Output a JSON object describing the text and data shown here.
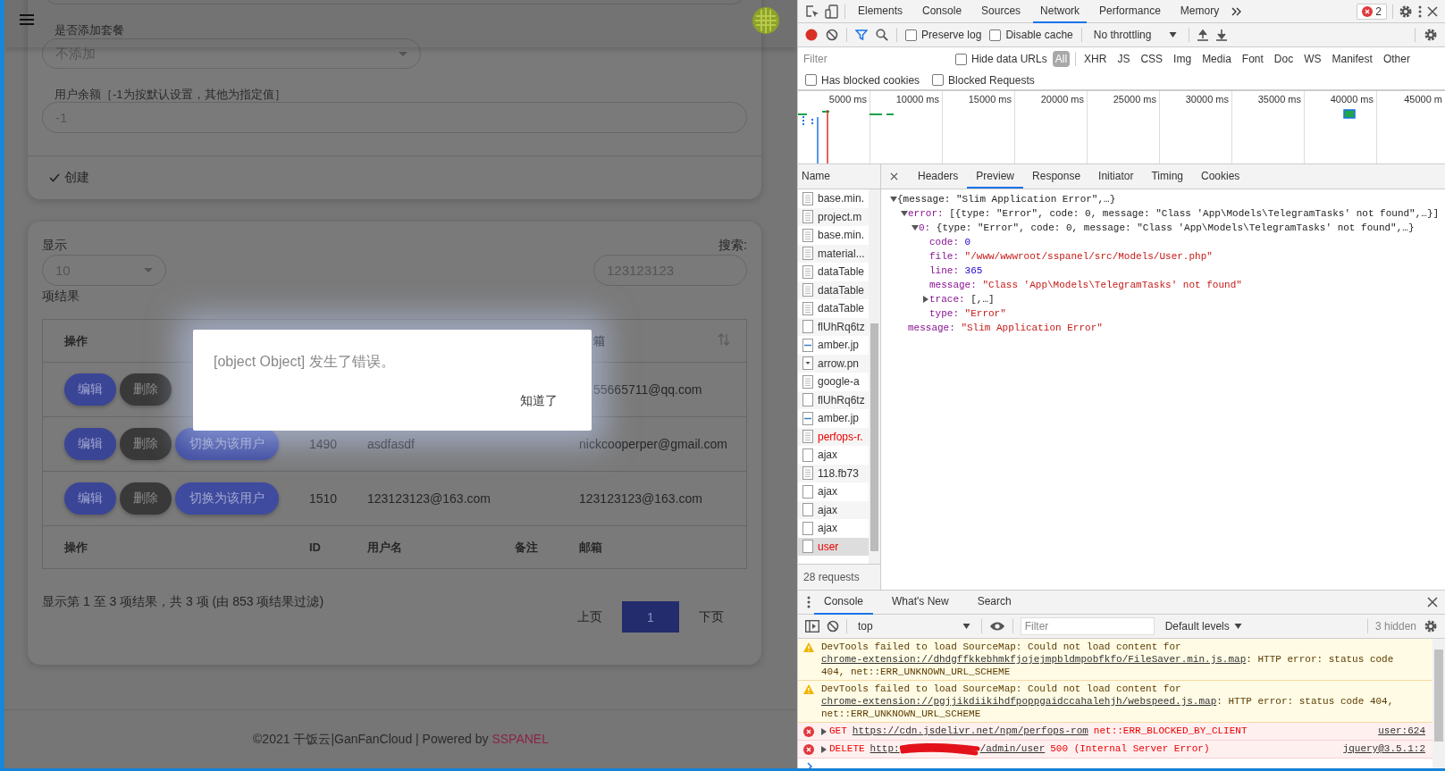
{
  "page": {
    "form": {
      "package_label": "是否添加套餐",
      "package_value": "不添加",
      "balance_label": "用户余额［-1为按默认设置，其他为指定值］",
      "balance_value": "-1",
      "create_button": "创建"
    },
    "list": {
      "show_label": "显示",
      "page_size": "10",
      "results_label": "项结果",
      "search_label": "搜索:",
      "search_value": "123123123",
      "header": {
        "actions": "操作",
        "email": "箱"
      },
      "rows": [
        {
          "buttons": [
            {
              "kind": "edit",
              "label": "编辑"
            },
            {
              "kind": "delete",
              "label": "删除"
            }
          ],
          "email": "55665711@qq.com"
        },
        {
          "buttons": [
            {
              "kind": "edit",
              "label": "编辑"
            },
            {
              "kind": "delete",
              "label": "删除"
            },
            {
              "kind": "switch",
              "label": "切换为该用户"
            }
          ],
          "id": "1490",
          "username": "asdfasdf",
          "email": "nickcooperper@gmail.com"
        },
        {
          "buttons": [
            {
              "kind": "edit",
              "label": "编辑"
            },
            {
              "kind": "delete",
              "label": "删除"
            },
            {
              "kind": "switch",
              "label": "切换为该用户"
            }
          ],
          "id": "1510",
          "username": "123123123@163.com",
          "email": "123123123@163.com"
        }
      ],
      "footer": {
        "actions": "操作",
        "id": "ID",
        "username": "用户名",
        "note": "备注",
        "email": "邮箱"
      },
      "info": "显示第 1 至 3 项结果，共 3 项 (由 853 项结果过滤)",
      "pages": [
        {
          "label": "上页",
          "selected": false
        },
        {
          "label": "1",
          "selected": true
        },
        {
          "label": "下页",
          "selected": false
        }
      ]
    },
    "dialog": {
      "message": "[object Object] 发生了错误。",
      "button": "知道了"
    },
    "footer": {
      "text": "©2021 干饭云|GanFanCloud | Powered by ",
      "link": "SSPANEL"
    }
  },
  "devtools": {
    "tabs": [
      {
        "label": "Elements",
        "selected": false
      },
      {
        "label": "Console",
        "selected": false
      },
      {
        "label": "Sources",
        "selected": false
      },
      {
        "label": "Network",
        "selected": true
      },
      {
        "label": "Performance",
        "selected": false
      },
      {
        "label": "Memory",
        "selected": false
      }
    ],
    "error_count": "2",
    "recording": true,
    "preserve_log": {
      "label": "Preserve log",
      "checked": false
    },
    "disable_cache": {
      "label": "Disable cache",
      "checked": false
    },
    "throttling": "No throttling",
    "filter_placeholder": "Filter",
    "hide_data_urls": {
      "label": "Hide data URLs",
      "checked": false
    },
    "type_filters": [
      {
        "label": "All",
        "selected": true
      },
      {
        "label": "XHR",
        "selected": false
      },
      {
        "label": "JS",
        "selected": false
      },
      {
        "label": "CSS",
        "selected": false
      },
      {
        "label": "Img",
        "selected": false
      },
      {
        "label": "Media",
        "selected": false
      },
      {
        "label": "Font",
        "selected": false
      },
      {
        "label": "Doc",
        "selected": false
      },
      {
        "label": "WS",
        "selected": false
      },
      {
        "label": "Manifest",
        "selected": false
      },
      {
        "label": "Other",
        "selected": false
      }
    ],
    "blocked_cookies": {
      "label": "Has blocked cookies",
      "checked": false
    },
    "blocked_requests": {
      "label": "Blocked Requests",
      "checked": false
    },
    "timeline_ticks": [
      "5000 ms",
      "10000 ms",
      "15000 ms",
      "20000 ms",
      "25000 ms",
      "30000 ms",
      "35000 ms",
      "40000 ms",
      "45000 m"
    ],
    "name_header": "Name",
    "requests": [
      {
        "name": "base.min.",
        "kind": "doc",
        "failed": false,
        "selected": false
      },
      {
        "name": "project.m",
        "kind": "doc",
        "failed": false,
        "selected": false
      },
      {
        "name": "base.min.",
        "kind": "doc",
        "failed": false,
        "selected": false
      },
      {
        "name": "material...",
        "kind": "doc",
        "failed": false,
        "selected": false
      },
      {
        "name": "dataTable",
        "kind": "doc",
        "failed": false,
        "selected": false
      },
      {
        "name": "dataTable",
        "kind": "doc",
        "failed": false,
        "selected": false
      },
      {
        "name": "dataTable",
        "kind": "doc",
        "failed": false,
        "selected": false
      },
      {
        "name": "flUhRq6tz",
        "kind": "blank",
        "failed": false,
        "selected": false
      },
      {
        "name": "amber.jp",
        "kind": "image",
        "failed": false,
        "selected": false
      },
      {
        "name": "arrow.pn",
        "kind": "arrow",
        "failed": false,
        "selected": false
      },
      {
        "name": "google-a",
        "kind": "doc",
        "failed": false,
        "selected": false
      },
      {
        "name": "flUhRq6tz",
        "kind": "blank",
        "failed": false,
        "selected": false
      },
      {
        "name": "amber.jp",
        "kind": "image",
        "failed": false,
        "selected": false
      },
      {
        "name": "perfops-r.",
        "kind": "doc",
        "failed": true,
        "selected": false
      },
      {
        "name": "ajax",
        "kind": "blank",
        "failed": false,
        "selected": false
      },
      {
        "name": "118.fb73",
        "kind": "doc",
        "failed": false,
        "selected": false
      },
      {
        "name": "ajax",
        "kind": "blank",
        "failed": false,
        "selected": false
      },
      {
        "name": "ajax",
        "kind": "blank",
        "failed": false,
        "selected": false
      },
      {
        "name": "ajax",
        "kind": "blank",
        "failed": false,
        "selected": false
      },
      {
        "name": "user",
        "kind": "blank",
        "failed": true,
        "selected": true
      }
    ],
    "request_count": "28 requests",
    "detail_tabs": [
      {
        "label": "Headers",
        "selected": false
      },
      {
        "label": "Preview",
        "selected": true
      },
      {
        "label": "Response",
        "selected": false
      },
      {
        "label": "Initiator",
        "selected": false
      },
      {
        "label": "Timing",
        "selected": false
      },
      {
        "label": "Cookies",
        "selected": false
      }
    ],
    "preview": {
      "value": "{message: \"Slim Application Error\",…}",
      "kind": "object",
      "expanded": true,
      "children": [
        {
          "key": "error:",
          "value": "[{type: \"Error\", code: 0, message: \"Class 'App\\Models\\TelegramTasks' not found\",…}]",
          "kind": "object",
          "expanded": true,
          "children": [
            {
              "key": "0:",
              "value": "{type: \"Error\", code: 0, message: \"Class 'App\\Models\\TelegramTasks' not found\",…}",
              "kind": "object",
              "expanded": true,
              "children": [
                {
                  "key": "code:",
                  "value": "0",
                  "kind": "number"
                },
                {
                  "key": "file:",
                  "value": "\"/www/wwwroot/sspanel/src/Models/User.php\"",
                  "kind": "string"
                },
                {
                  "key": "line:",
                  "value": "365",
                  "kind": "number"
                },
                {
                  "key": "message:",
                  "value": "\"Class 'App\\Models\\TelegramTasks' not found\"",
                  "kind": "string"
                },
                {
                  "key": "trace:",
                  "value": "[,…]",
                  "kind": "object",
                  "expanded": false
                },
                {
                  "key": "type:",
                  "value": "\"Error\"",
                  "kind": "string"
                }
              ]
            }
          ]
        },
        {
          "key": "message:",
          "value": "\"Slim Application Error\"",
          "kind": "string"
        }
      ]
    },
    "drawer_tabs": [
      {
        "label": "Console",
        "selected": true
      },
      {
        "label": "What's New",
        "selected": false
      },
      {
        "label": "Search",
        "selected": false
      }
    ],
    "console_context": "top",
    "console_filter_placeholder": "Filter",
    "levels": "Default levels",
    "hidden_count": "3 hidden",
    "messages": [
      {
        "kind": "warning",
        "parts": [
          {
            "text": "DevTools failed to load SourceMap: Could not load content for "
          },
          {
            "text": "chrome-extension://dhdgffkkebhmkfjojejmpbldmpobfkfo/FileSaver.min.js.map",
            "link": true
          },
          {
            "text": ": HTTP error: status code 404, net::ERR_UNKNOWN_URL_SCHEME"
          }
        ]
      },
      {
        "kind": "warning",
        "parts": [
          {
            "text": "DevTools failed to load SourceMap: Could not load content for "
          },
          {
            "text": "chrome-extension://pgjjikdiikihdfpoppgaidccahalehjh/webspeed.js.map",
            "link": true
          },
          {
            "text": ": HTTP error: status code 404, net::ERR_UNKNOWN_URL_SCHEME"
          }
        ]
      },
      {
        "kind": "error",
        "method": "GET",
        "url": "https://cdn.jsdelivr.net/npm/perfops-rom",
        "text": "net::ERR_BLOCKED_BY_CLIENT",
        "source": "user:624"
      },
      {
        "kind": "error",
        "method": "DELETE",
        "url": "http:",
        "redacted": true,
        "url_end": "/admin/user",
        "text": "500 (Internal Server Error)",
        "source": "jquery@3.5.1:2"
      }
    ]
  }
}
